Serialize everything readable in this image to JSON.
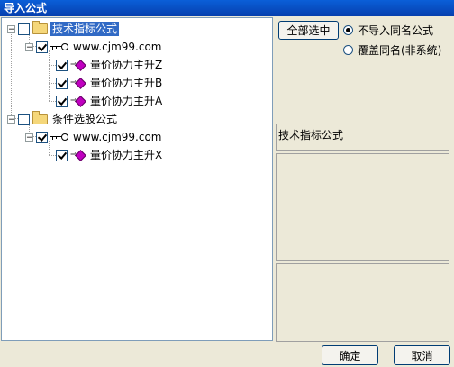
{
  "window": {
    "title": "导入公式"
  },
  "tree": {
    "groups": [
      {
        "label": "技术指标公式",
        "expander": "−",
        "source": {
          "label": "www.cjm99.com",
          "expander": "−"
        },
        "items": [
          {
            "label": "量价协力主升Z"
          },
          {
            "label": "量价协力主升B"
          },
          {
            "label": "量价协力主升A"
          }
        ]
      },
      {
        "label": "条件选股公式",
        "expander": "−",
        "source": {
          "label": "www.cjm99.com",
          "expander": "−"
        },
        "items": [
          {
            "label": "量价协力主升X"
          }
        ]
      }
    ]
  },
  "options": {
    "select_all_label": "全部选中",
    "radio_no_import": "不导入同名公式",
    "radio_overwrite": "覆盖同名(非系统)",
    "selected_option": "不导入同名公式"
  },
  "info": {
    "category": "技术指标公式"
  },
  "buttons": {
    "ok": "确定",
    "cancel": "取消"
  }
}
